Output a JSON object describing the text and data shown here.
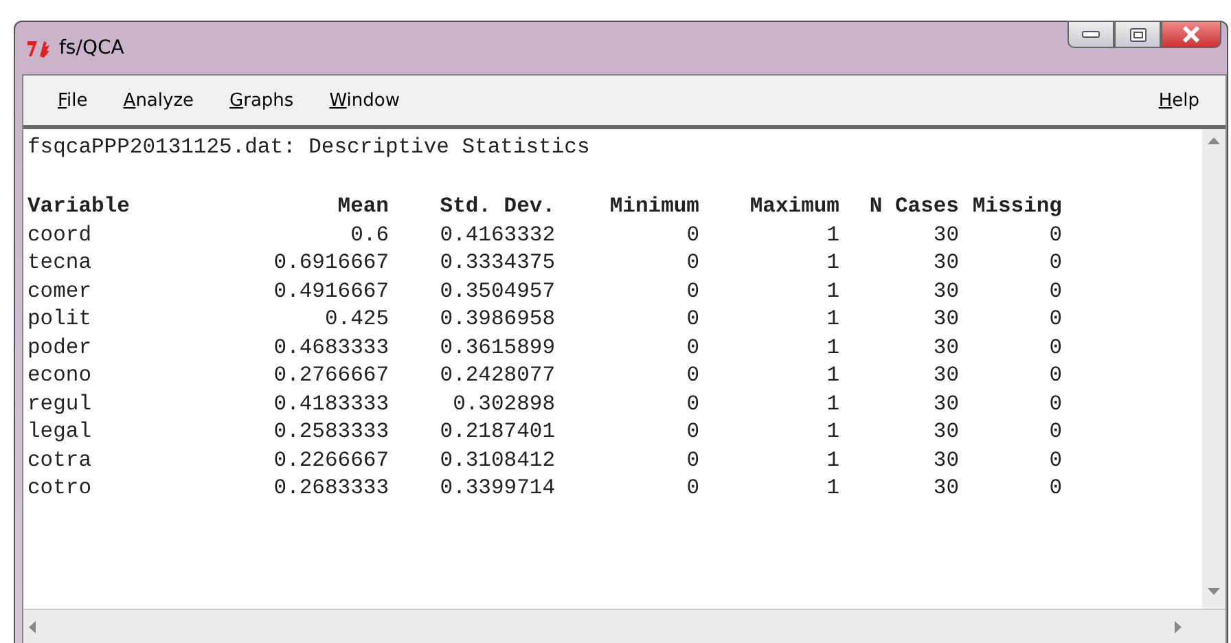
{
  "window": {
    "title": "fs/QCA"
  },
  "menu": [
    {
      "label": "File"
    },
    {
      "label": "Analyze"
    },
    {
      "label": "Graphs"
    },
    {
      "label": "Window"
    },
    {
      "label": "Help"
    }
  ],
  "output": {
    "heading": "fsqcaPPP20131125.dat: Descriptive Statistics",
    "columns": [
      "Variable",
      "Mean",
      "Std. Dev.",
      "Minimum",
      "Maximum",
      "N Cases",
      "Missing"
    ],
    "rows": [
      [
        "coord",
        "0.6",
        "0.4163332",
        "0",
        "1",
        "30",
        "0"
      ],
      [
        "tecna",
        "0.6916667",
        "0.3334375",
        "0",
        "1",
        "30",
        "0"
      ],
      [
        "comer",
        "0.4916667",
        "0.3504957",
        "0",
        "1",
        "30",
        "0"
      ],
      [
        "polit",
        "0.425",
        "0.3986958",
        "0",
        "1",
        "30",
        "0"
      ],
      [
        "poder",
        "0.4683333",
        "0.3615899",
        "0",
        "1",
        "30",
        "0"
      ],
      [
        "econo",
        "0.2766667",
        "0.2428077",
        "0",
        "1",
        "30",
        "0"
      ],
      [
        "regul",
        "0.4183333",
        "0.302898",
        "0",
        "1",
        "30",
        "0"
      ],
      [
        "legal",
        "0.2583333",
        "0.2187401",
        "0",
        "1",
        "30",
        "0"
      ],
      [
        "cotra",
        "0.2266667",
        "0.3108412",
        "0",
        "1",
        "30",
        "0"
      ],
      [
        "cotro",
        "0.2683333",
        "0.3399714",
        "0",
        "1",
        "30",
        "0"
      ]
    ]
  }
}
